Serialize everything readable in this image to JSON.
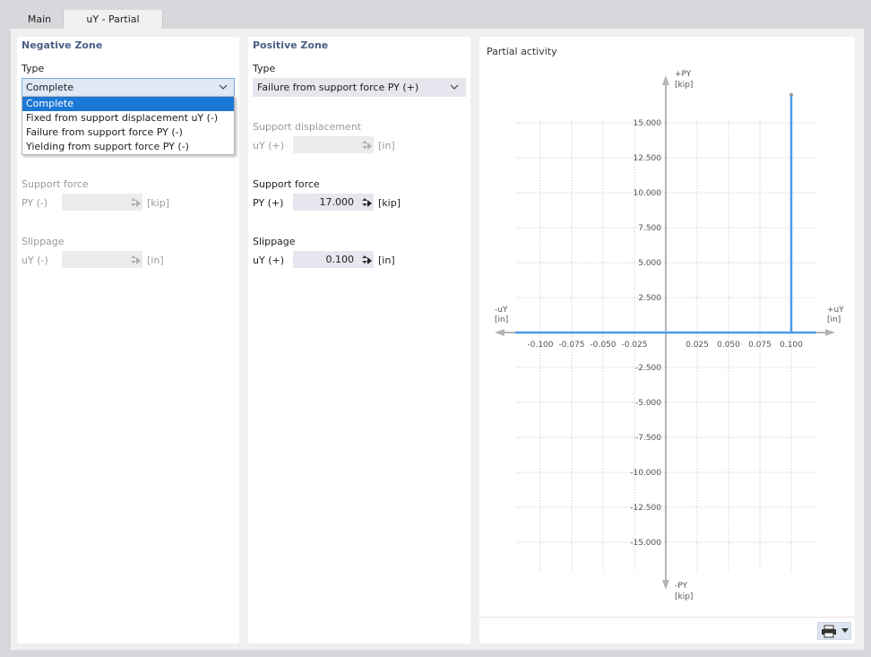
{
  "tabs": [
    {
      "label": "Main"
    },
    {
      "label": "uY - Partial Activity"
    }
  ],
  "negative_zone": {
    "title": "Negative Zone",
    "type_label": "Type",
    "type_value": "Complete",
    "dropdown_options": [
      "Complete",
      "Fixed from support displacement uY (-)",
      "Failure from support force PY (-)",
      "Yielding from support force PY (-)"
    ],
    "support_force": {
      "section": "Support force",
      "label": "PY (-)",
      "value": "",
      "unit": "[kip]"
    },
    "slippage": {
      "section": "Slippage",
      "label": "uY (-)",
      "value": "",
      "unit": "[in]"
    }
  },
  "positive_zone": {
    "title": "Positive Zone",
    "type_label": "Type",
    "type_value": "Failure from support force PY (+)",
    "support_displacement": {
      "section": "Support displacement",
      "label": "uY (+)",
      "value": "",
      "unit": "[in]"
    },
    "support_force": {
      "section": "Support force",
      "label": "PY (+)",
      "value": "17.000",
      "unit": "[kip]"
    },
    "slippage": {
      "section": "Slippage",
      "label": "uY (+)",
      "value": "0.100",
      "unit": "[in]"
    }
  },
  "chart_panel": {
    "title": "Partial activity"
  },
  "chart_data": {
    "type": "line",
    "title": "Partial activity",
    "x_axis": {
      "label_pos": "+uY",
      "label_neg": "-uY",
      "unit": "[in]",
      "range": [
        -0.12,
        0.12
      ],
      "ticks": [
        -0.1,
        -0.075,
        -0.05,
        -0.025,
        0.025,
        0.05,
        0.075,
        0.1
      ],
      "tick_labels": [
        "-0.100",
        "-0.075",
        "-0.050",
        "-0.025",
        "0.025",
        "0.050",
        "0.075",
        "0.100"
      ]
    },
    "y_axis": {
      "label_pos": "+PY",
      "label_neg": "-PY",
      "unit": "[kip]",
      "range": [
        -17.5,
        17.5
      ],
      "ticks": [
        15,
        12.5,
        10,
        7.5,
        5,
        2.5,
        -2.5,
        -5,
        -7.5,
        -10,
        -12.5,
        -15
      ],
      "tick_labels": [
        "15.000",
        "12.500",
        "10.000",
        "7.500",
        "5.000",
        "2.500",
        "-2.500",
        "-5.000",
        "-7.500",
        "-10.000",
        "-12.500",
        "-15.000"
      ]
    },
    "grid": true,
    "series": [
      {
        "color": "#4a9be8",
        "points": [
          [
            -0.12,
            0
          ],
          [
            0.1,
            0
          ],
          [
            0.1,
            17
          ],
          [
            0.1,
            0
          ],
          [
            0.12,
            0
          ]
        ]
      }
    ]
  },
  "colors": {
    "accent": "#4a5f86",
    "selection": "#1b78d6",
    "series": "#4a9be8"
  },
  "icons": {
    "print": "printer-icon",
    "dropdown": "chevron-down-icon"
  }
}
